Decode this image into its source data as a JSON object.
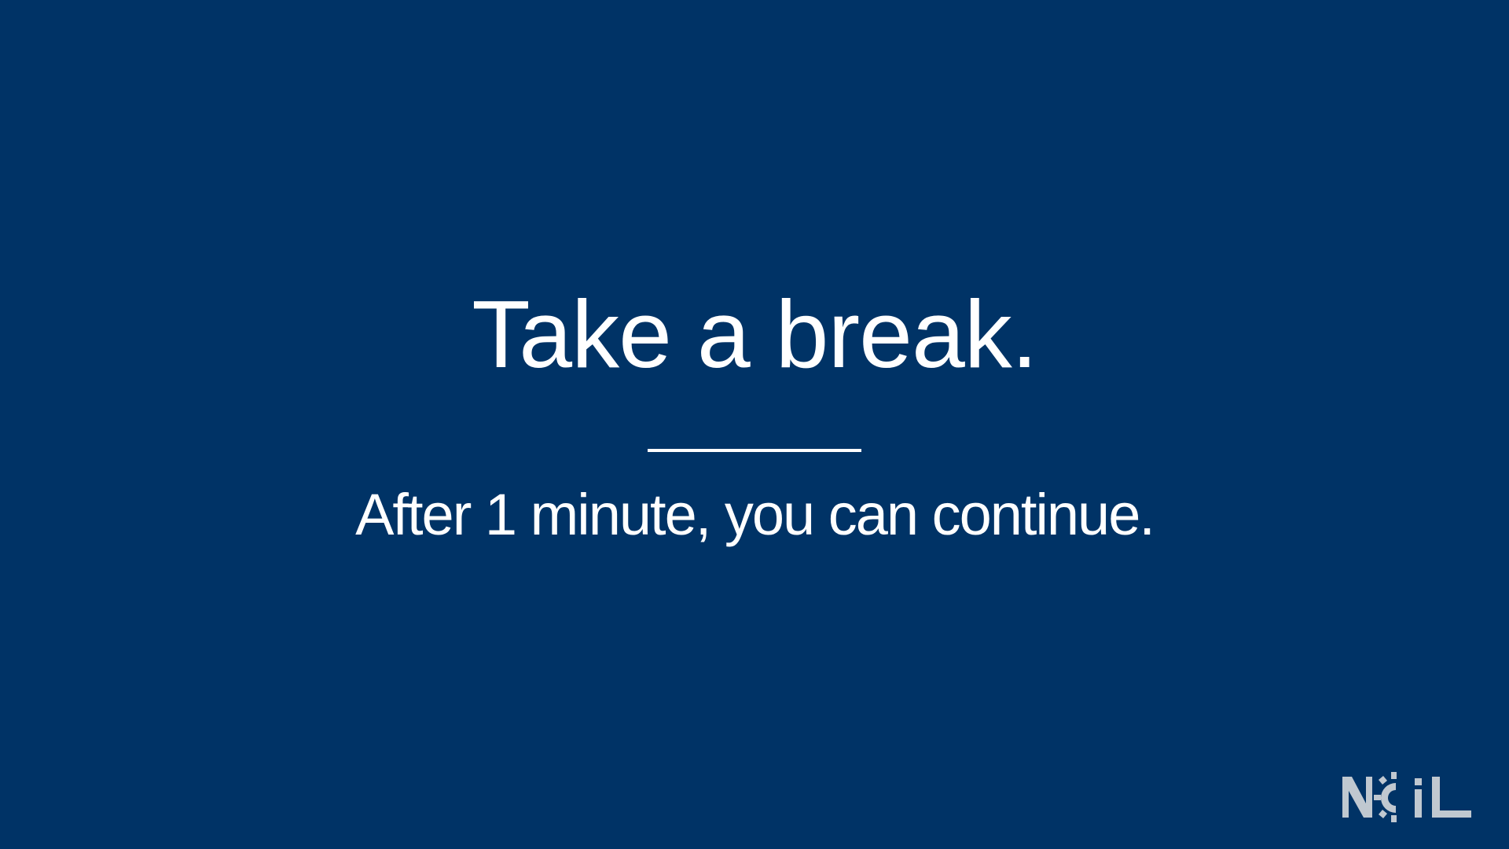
{
  "slide": {
    "title": "Take a break.",
    "subtitle": "After 1 minute, you can continue."
  },
  "logo": {
    "text": "NCiL",
    "icon": "gear-icon"
  },
  "colors": {
    "background": "#003366",
    "text": "#ffffff",
    "logo": "#c0c8d0"
  }
}
